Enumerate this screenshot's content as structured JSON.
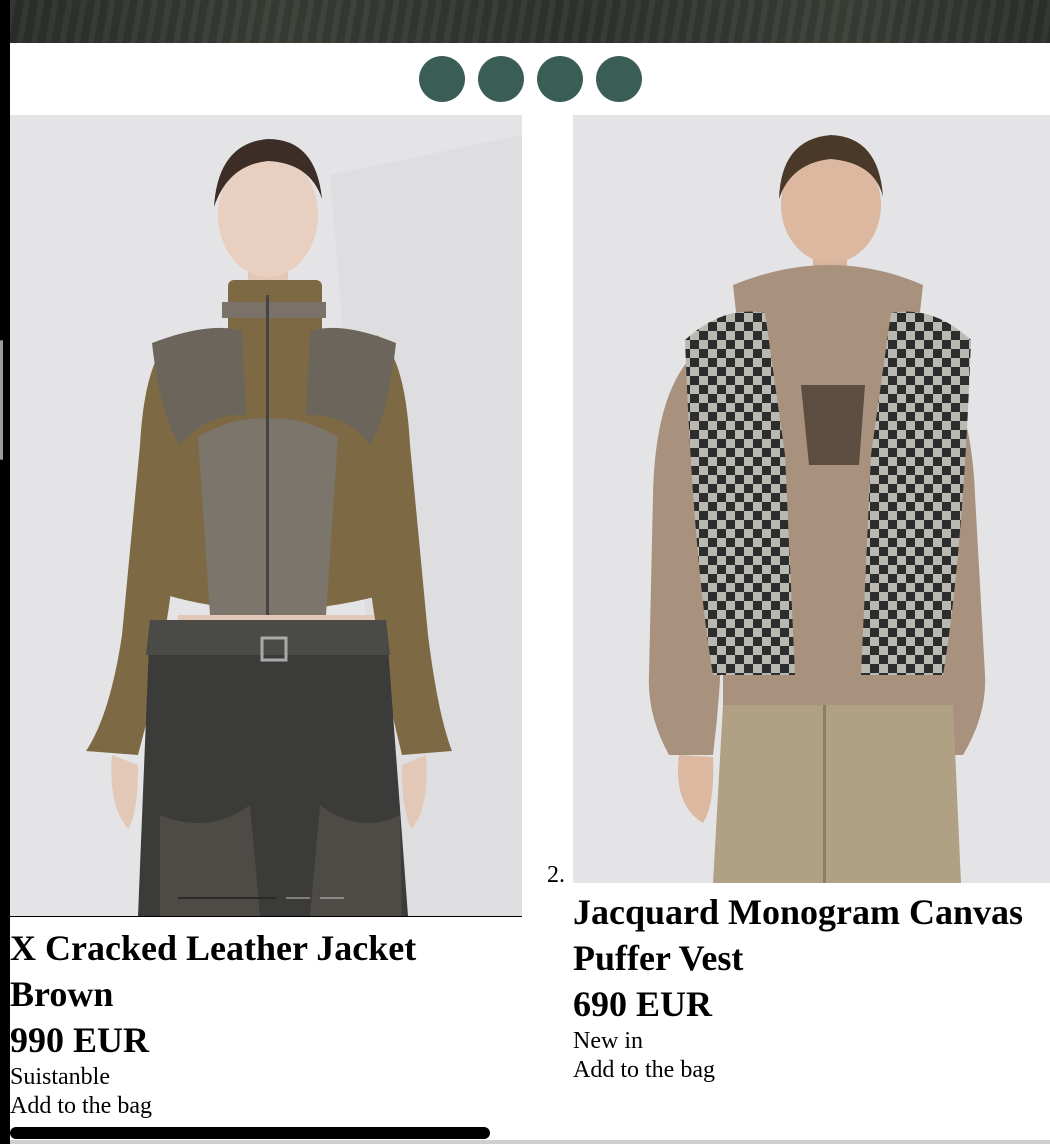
{
  "carousel": {
    "dot_count": 4,
    "dot_color": "#3a5e56"
  },
  "products": [
    {
      "title_line1": "X Cracked Leather Jacket",
      "title_line2": "Brown",
      "price": "990 EUR",
      "tag": "Suistanble",
      "cta": "Add to the bag",
      "image_slides": 3,
      "active_slide": 1
    },
    {
      "index": "2.",
      "title_line1": "Jacquard Monogram Canvas",
      "title_line2": "Puffer Vest",
      "price": "690 EUR",
      "tag": "New in",
      "cta": "Add to the bag"
    }
  ],
  "colors": {
    "accent": "#3a5e56",
    "image_bg": "#e4e4e6"
  }
}
